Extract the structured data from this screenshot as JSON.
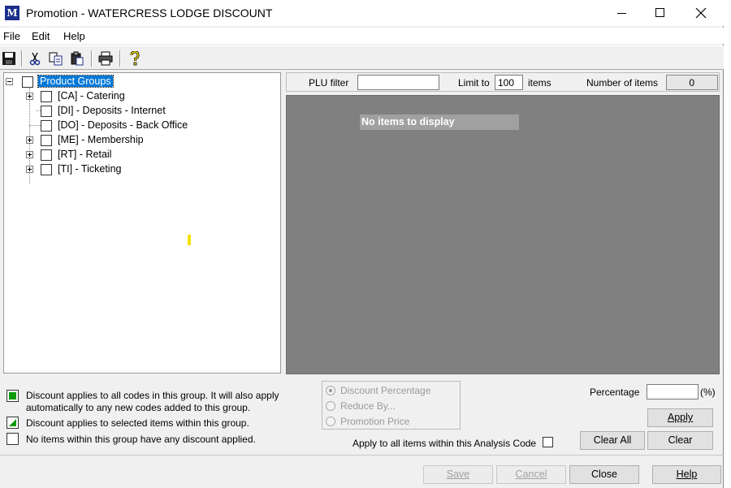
{
  "window": {
    "icon_text": "M",
    "title": "Promotion - WATERCRESS LODGE DISCOUNT"
  },
  "menu": [
    "File",
    "Edit",
    "Help"
  ],
  "toolbar": {
    "icons": [
      "save-icon",
      "cut-icon",
      "copy-icon",
      "paste-icon",
      "print-icon",
      "help-icon"
    ]
  },
  "tree": {
    "root": "Product Groups",
    "items": [
      {
        "label": "[CA] - Catering",
        "expandable": true
      },
      {
        "label": "[DI] - Deposits - Internet",
        "expandable": false
      },
      {
        "label": "[DO] - Deposits - Back Office",
        "expandable": false
      },
      {
        "label": "[ME] - Membership",
        "expandable": true
      },
      {
        "label": "[RT] - Retail",
        "expandable": true
      },
      {
        "label": "[TI] - Ticketing",
        "expandable": true
      }
    ]
  },
  "filter": {
    "plu_label": "PLU filter",
    "plu_value": "",
    "limit_label": "Limit to",
    "limit_value": "100",
    "items_label": "items",
    "count_label": "Number of items",
    "count_value": "0"
  },
  "items_area": {
    "empty_text": "No items to display"
  },
  "legend": {
    "full": "Discount applies to all codes in this group. It will also apply automatically to any new codes added to this group.",
    "partial": "Discount applies to selected items within this group.",
    "none": "No items within this group have any discount applied."
  },
  "discount_type": {
    "options": [
      "Discount Percentage",
      "Reduce By...",
      "Promotion Price"
    ],
    "selected": "Discount Percentage"
  },
  "apply_all_label": "Apply to all items within this Analysis Code",
  "percentage": {
    "label": "Percentage",
    "value": "",
    "unit": "(%)"
  },
  "buttons": {
    "apply": "Apply",
    "clear_all": "Clear All",
    "clear": "Clear",
    "save": "Save",
    "cancel": "Cancel",
    "close": "Close",
    "help": "Help"
  },
  "colors": {
    "selection": "#0078d7",
    "items_background": "#808080",
    "discount_green": "#0a9a0a"
  }
}
